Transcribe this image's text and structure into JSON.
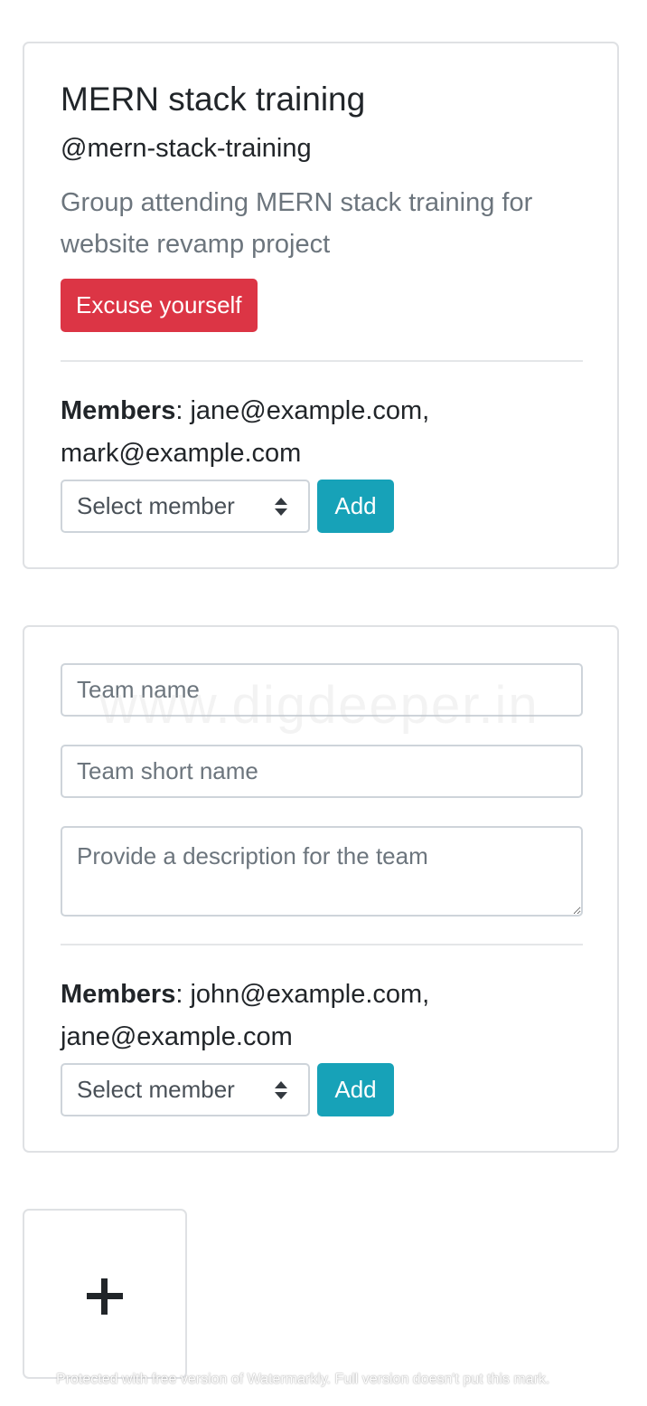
{
  "team_card": {
    "name": "MERN stack training",
    "handle": "@mern-stack-training",
    "description": "Group attending MERN stack training for website revamp project",
    "excuse_button": "Excuse yourself",
    "members_label": "Members",
    "members": "jane@example.com, mark@example.com",
    "select_value": "Select member",
    "add_button": "Add"
  },
  "new_team_form": {
    "name_placeholder": "Team name",
    "short_name_placeholder": "Team short name",
    "description_placeholder": "Provide a description for the team",
    "members_label": "Members",
    "members": "john@example.com, jane@example.com",
    "select_value": "Select member",
    "add_button": "Add"
  },
  "add_team_tile": {
    "icon": "plus-icon"
  },
  "watermarks": {
    "center": "www.digdeeper.in",
    "footer": "Protected with free version of Watermarkly. Full version doesn't put this mark."
  },
  "colors": {
    "danger": "#dc3545",
    "info": "#17a2b8",
    "muted_text": "#6c757d",
    "border": "#dfe1e4"
  }
}
